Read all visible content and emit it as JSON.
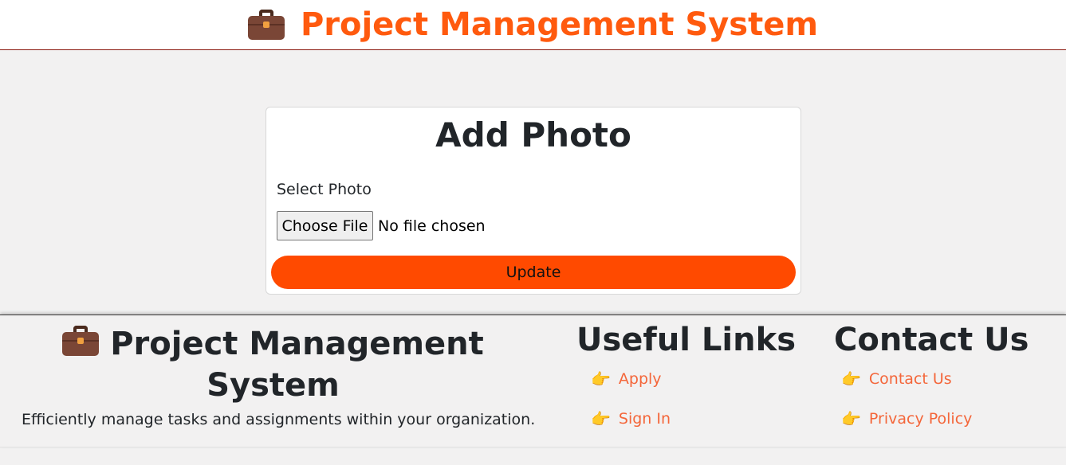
{
  "header": {
    "title": "Project Management System",
    "icon": "briefcase-icon"
  },
  "card": {
    "title": "Add Photo",
    "field_label": "Select Photo",
    "file_button_label": "Choose File",
    "file_status": "No file chosen",
    "update_label": "Update"
  },
  "footer": {
    "brand_title": "Project Management System",
    "description": "Efficiently manage tasks and assignments within your organization.",
    "useful_links": {
      "title": "Useful Links",
      "items": [
        {
          "label": "Apply"
        },
        {
          "label": "Sign In"
        }
      ]
    },
    "contact": {
      "title": "Contact Us",
      "items": [
        {
          "label": "Contact Us"
        },
        {
          "label": "Privacy Policy"
        }
      ]
    }
  },
  "colors": {
    "accent": "#ff5a0e",
    "button": "#ff4a00",
    "link": "#f4663a",
    "background": "#f2f1f1"
  }
}
